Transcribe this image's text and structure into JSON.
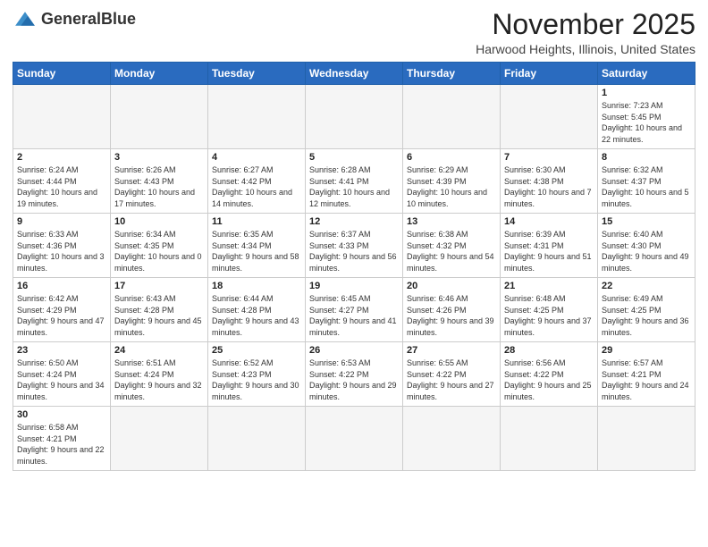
{
  "header": {
    "logo_text_light": "General",
    "logo_text_bold": "Blue",
    "month": "November 2025",
    "location": "Harwood Heights, Illinois, United States"
  },
  "weekdays": [
    "Sunday",
    "Monday",
    "Tuesday",
    "Wednesday",
    "Thursday",
    "Friday",
    "Saturday"
  ],
  "weeks": [
    [
      {
        "day": "",
        "info": ""
      },
      {
        "day": "",
        "info": ""
      },
      {
        "day": "",
        "info": ""
      },
      {
        "day": "",
        "info": ""
      },
      {
        "day": "",
        "info": ""
      },
      {
        "day": "",
        "info": ""
      },
      {
        "day": "1",
        "info": "Sunrise: 7:23 AM\nSunset: 5:45 PM\nDaylight: 10 hours and 22 minutes."
      }
    ],
    [
      {
        "day": "2",
        "info": "Sunrise: 6:24 AM\nSunset: 4:44 PM\nDaylight: 10 hours and 19 minutes."
      },
      {
        "day": "3",
        "info": "Sunrise: 6:26 AM\nSunset: 4:43 PM\nDaylight: 10 hours and 17 minutes."
      },
      {
        "day": "4",
        "info": "Sunrise: 6:27 AM\nSunset: 4:42 PM\nDaylight: 10 hours and 14 minutes."
      },
      {
        "day": "5",
        "info": "Sunrise: 6:28 AM\nSunset: 4:41 PM\nDaylight: 10 hours and 12 minutes."
      },
      {
        "day": "6",
        "info": "Sunrise: 6:29 AM\nSunset: 4:39 PM\nDaylight: 10 hours and 10 minutes."
      },
      {
        "day": "7",
        "info": "Sunrise: 6:30 AM\nSunset: 4:38 PM\nDaylight: 10 hours and 7 minutes."
      },
      {
        "day": "8",
        "info": "Sunrise: 6:32 AM\nSunset: 4:37 PM\nDaylight: 10 hours and 5 minutes."
      }
    ],
    [
      {
        "day": "9",
        "info": "Sunrise: 6:33 AM\nSunset: 4:36 PM\nDaylight: 10 hours and 3 minutes."
      },
      {
        "day": "10",
        "info": "Sunrise: 6:34 AM\nSunset: 4:35 PM\nDaylight: 10 hours and 0 minutes."
      },
      {
        "day": "11",
        "info": "Sunrise: 6:35 AM\nSunset: 4:34 PM\nDaylight: 9 hours and 58 minutes."
      },
      {
        "day": "12",
        "info": "Sunrise: 6:37 AM\nSunset: 4:33 PM\nDaylight: 9 hours and 56 minutes."
      },
      {
        "day": "13",
        "info": "Sunrise: 6:38 AM\nSunset: 4:32 PM\nDaylight: 9 hours and 54 minutes."
      },
      {
        "day": "14",
        "info": "Sunrise: 6:39 AM\nSunset: 4:31 PM\nDaylight: 9 hours and 51 minutes."
      },
      {
        "day": "15",
        "info": "Sunrise: 6:40 AM\nSunset: 4:30 PM\nDaylight: 9 hours and 49 minutes."
      }
    ],
    [
      {
        "day": "16",
        "info": "Sunrise: 6:42 AM\nSunset: 4:29 PM\nDaylight: 9 hours and 47 minutes."
      },
      {
        "day": "17",
        "info": "Sunrise: 6:43 AM\nSunset: 4:28 PM\nDaylight: 9 hours and 45 minutes."
      },
      {
        "day": "18",
        "info": "Sunrise: 6:44 AM\nSunset: 4:28 PM\nDaylight: 9 hours and 43 minutes."
      },
      {
        "day": "19",
        "info": "Sunrise: 6:45 AM\nSunset: 4:27 PM\nDaylight: 9 hours and 41 minutes."
      },
      {
        "day": "20",
        "info": "Sunrise: 6:46 AM\nSunset: 4:26 PM\nDaylight: 9 hours and 39 minutes."
      },
      {
        "day": "21",
        "info": "Sunrise: 6:48 AM\nSunset: 4:25 PM\nDaylight: 9 hours and 37 minutes."
      },
      {
        "day": "22",
        "info": "Sunrise: 6:49 AM\nSunset: 4:25 PM\nDaylight: 9 hours and 36 minutes."
      }
    ],
    [
      {
        "day": "23",
        "info": "Sunrise: 6:50 AM\nSunset: 4:24 PM\nDaylight: 9 hours and 34 minutes."
      },
      {
        "day": "24",
        "info": "Sunrise: 6:51 AM\nSunset: 4:24 PM\nDaylight: 9 hours and 32 minutes."
      },
      {
        "day": "25",
        "info": "Sunrise: 6:52 AM\nSunset: 4:23 PM\nDaylight: 9 hours and 30 minutes."
      },
      {
        "day": "26",
        "info": "Sunrise: 6:53 AM\nSunset: 4:22 PM\nDaylight: 9 hours and 29 minutes."
      },
      {
        "day": "27",
        "info": "Sunrise: 6:55 AM\nSunset: 4:22 PM\nDaylight: 9 hours and 27 minutes."
      },
      {
        "day": "28",
        "info": "Sunrise: 6:56 AM\nSunset: 4:22 PM\nDaylight: 9 hours and 25 minutes."
      },
      {
        "day": "29",
        "info": "Sunrise: 6:57 AM\nSunset: 4:21 PM\nDaylight: 9 hours and 24 minutes."
      }
    ],
    [
      {
        "day": "30",
        "info": "Sunrise: 6:58 AM\nSunset: 4:21 PM\nDaylight: 9 hours and 22 minutes."
      },
      {
        "day": "",
        "info": ""
      },
      {
        "day": "",
        "info": ""
      },
      {
        "day": "",
        "info": ""
      },
      {
        "day": "",
        "info": ""
      },
      {
        "day": "",
        "info": ""
      },
      {
        "day": "",
        "info": ""
      }
    ]
  ]
}
